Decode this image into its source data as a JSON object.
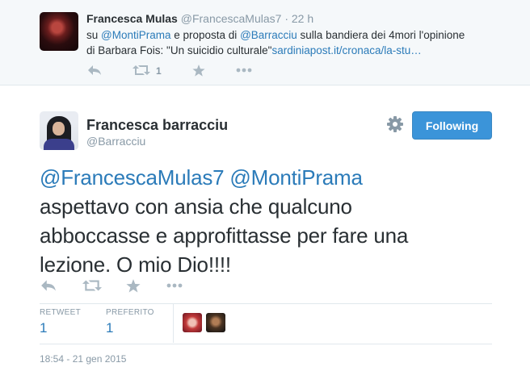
{
  "parent_tweet": {
    "name": "Francesca Mulas",
    "handle": "@FrancescaMulas7",
    "time": "· 22 h",
    "line1_prefix": "su ",
    "mention1": "@MontiPrama",
    "line1_mid": " e proposta di ",
    "mention2": "@Barracciu",
    "line1_suffix": " sulla bandiera dei 4mori l'opinione",
    "line2_text": "di Barbara Fois: \"Un suicidio culturale\"",
    "link": "sardiniapost.it/cronaca/la-stu…",
    "retweet_count": "1",
    "icons": [
      "reply-icon",
      "retweet-icon",
      "favorite-icon",
      "more-icon"
    ]
  },
  "tweet": {
    "name": "Francesca barracciu",
    "handle": "@Barracciu",
    "follow_label": "Following",
    "mention1": "@FrancescaMulas7",
    "mention2": "@MontiPrama",
    "line2": "aspettavo con ansia che qualcuno",
    "line3": "abboccasse e approfittasse per fare una",
    "line4": "lezione. O mio Dio!!!!",
    "icons": [
      "reply-icon",
      "retweet-icon",
      "favorite-icon",
      "more-icon",
      "gear-icon"
    ]
  },
  "stats": {
    "retweet_label": "RETWEET",
    "retweet_value": "1",
    "favorite_label": "PREFERITO",
    "favorite_value": "1"
  },
  "timestamp": "18:54 - 21 gen 2015",
  "colors": {
    "link": "#2b7bb9",
    "follow_button": "#3b94d9",
    "muted": "#8899a6",
    "icon": "#aab8c2",
    "parent_background": "#f5f8fa"
  }
}
